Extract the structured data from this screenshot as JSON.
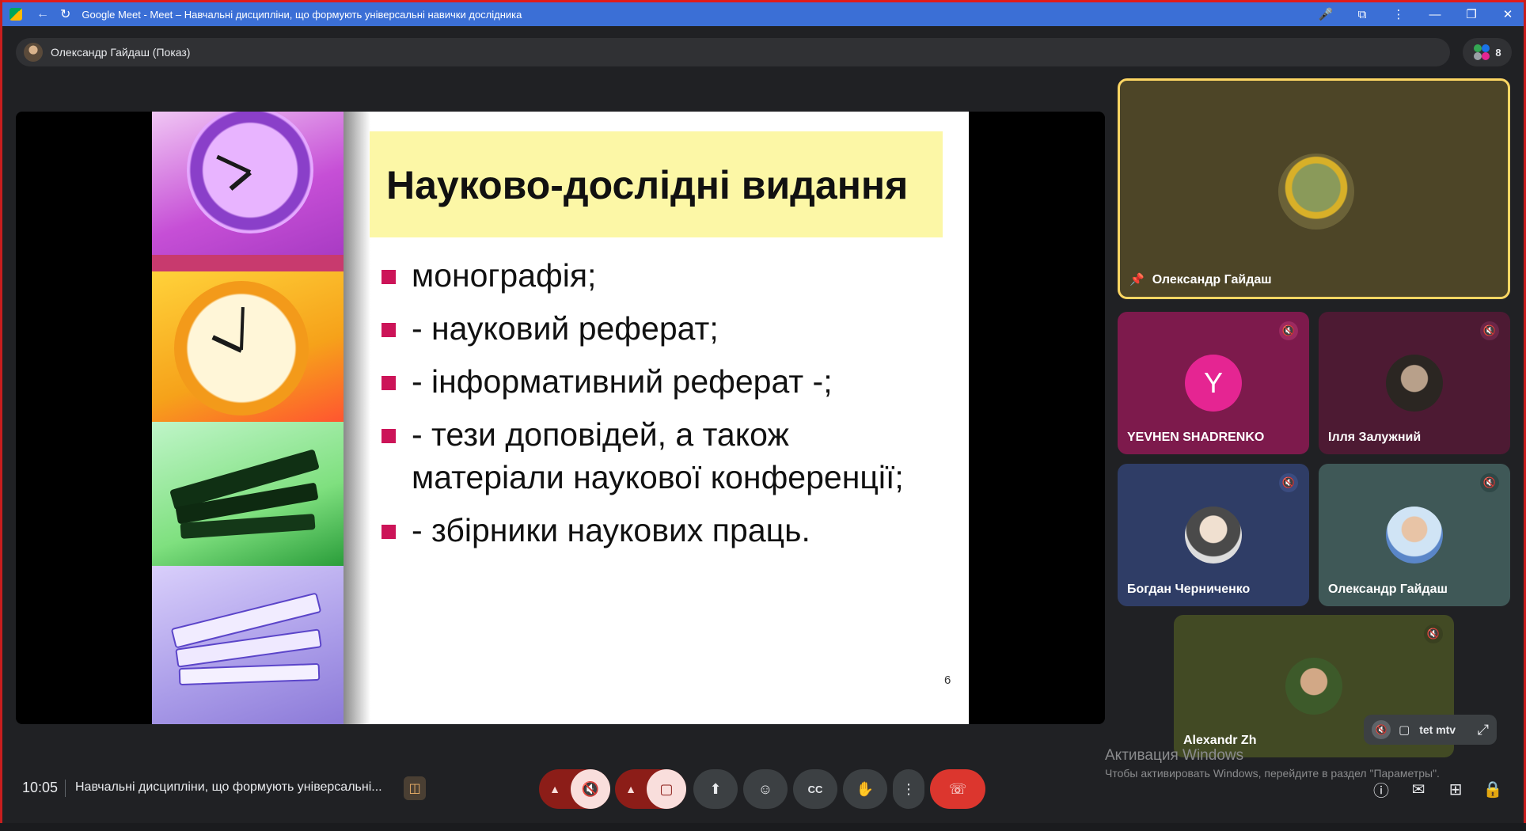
{
  "browser": {
    "title": "Google Meet - Meet – Навчальні дисципліни, що формують універсальні навички дослідника"
  },
  "presenter_bar": {
    "label": "Олександр Гайдаш (Показ)",
    "participant_count": "8"
  },
  "slide": {
    "title": "Науково-дослідні видання",
    "bullets": [
      "монографія;",
      "- науковий реферат;",
      "- інформативний реферат -;",
      "- тези доповідей, а також матеріали наукової конференції;",
      "- збірники наукових праць."
    ],
    "page_number": "6"
  },
  "participants": [
    {
      "name": "Олександр Гайдаш",
      "pinned": true
    },
    {
      "name": "YEVHEN SHADRENKO",
      "initial": "Y",
      "muted": true
    },
    {
      "name": "Ілля Залужний",
      "muted": true
    },
    {
      "name": "Богдан Черниченко",
      "muted": true
    },
    {
      "name": "Олександр Гайдаш",
      "muted": true
    },
    {
      "name": "Alexandr Zh",
      "muted": true
    }
  ],
  "self_view": {
    "name": "tet mtv"
  },
  "bottom_bar": {
    "time": "10:05",
    "meeting_title": "Навчальні дисципліни, що формують універсальні..."
  },
  "watermark": {
    "title": "Активация Windows",
    "subtitle": "Чтобы активировать Windows, перейдите в раздел \"Параметры\"."
  },
  "colors": {
    "accent_yellow": "#fdd663",
    "end_call": "#dc362e",
    "muted_pair": "#8c1d18",
    "bullet": "#cc1458"
  }
}
